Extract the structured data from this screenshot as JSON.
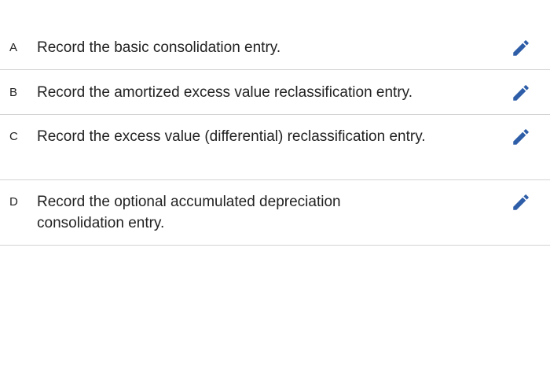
{
  "tasks": [
    {
      "letter": "A",
      "text": "Record the basic consolidation entry.",
      "action_icon": "pencil-icon"
    },
    {
      "letter": "B",
      "text": "Record the amortized excess value reclassification entry.",
      "action_icon": "pencil-icon"
    },
    {
      "letter": "C",
      "text": "Record the excess value (differential) reclassification entry.",
      "action_icon": "pencil-icon"
    },
    {
      "letter": "D",
      "text": "Record the optional accumulated depreciation consolidation entry.",
      "action_icon": "pencil-icon"
    }
  ],
  "colors": {
    "icon": "#2f5ea8",
    "divider": "#d3d3d3",
    "text": "#222222"
  }
}
